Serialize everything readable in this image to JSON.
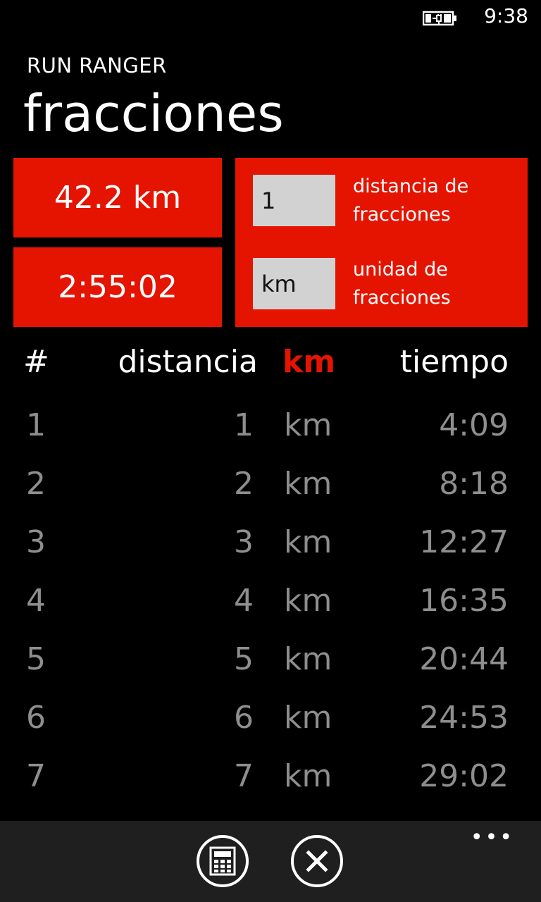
{
  "status_bar": {
    "battery_icon": "battery-charging-icon",
    "time": "9:38"
  },
  "header": {
    "app_title": "RUN RANGER",
    "page_title": "fracciones"
  },
  "summary": {
    "distance": "42.2 km",
    "time": "2:55:02"
  },
  "settings": {
    "interval_value": "1",
    "interval_label": "distancia de fracciones",
    "unit_value": "km",
    "unit_label": "unidad de fracciones"
  },
  "table": {
    "columns": {
      "index": "#",
      "distance": "distancia",
      "unit": "km",
      "time": "tiempo"
    },
    "rows": [
      {
        "index": "1",
        "distance": "1",
        "unit": "km",
        "time": "4:09"
      },
      {
        "index": "2",
        "distance": "2",
        "unit": "km",
        "time": "8:18"
      },
      {
        "index": "3",
        "distance": "3",
        "unit": "km",
        "time": "12:27"
      },
      {
        "index": "4",
        "distance": "4",
        "unit": "km",
        "time": "16:35"
      },
      {
        "index": "5",
        "distance": "5",
        "unit": "km",
        "time": "20:44"
      },
      {
        "index": "6",
        "distance": "6",
        "unit": "km",
        "time": "24:53"
      },
      {
        "index": "7",
        "distance": "7",
        "unit": "km",
        "time": "29:02"
      }
    ]
  },
  "app_bar": {
    "more_label": "•••",
    "buttons": [
      {
        "icon": "calculator-icon"
      },
      {
        "icon": "close-icon"
      }
    ]
  },
  "colors": {
    "accent": "#e51400",
    "background": "#000000",
    "row_text": "#8e8e8e",
    "field_bg": "#d2d2d2",
    "app_bar_bg": "#1f1f1f"
  }
}
